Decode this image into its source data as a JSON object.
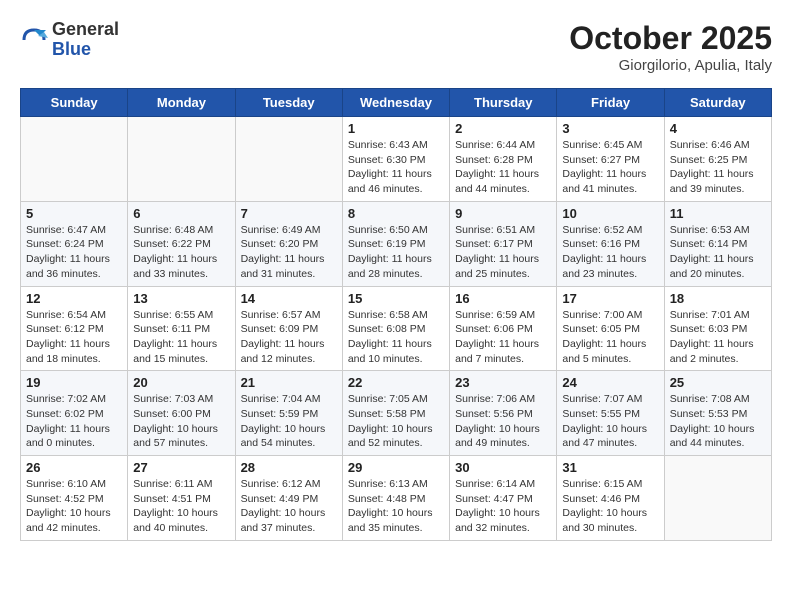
{
  "logo": {
    "general": "General",
    "blue": "Blue"
  },
  "header": {
    "month": "October 2025",
    "location": "Giorgilorio, Apulia, Italy"
  },
  "weekdays": [
    "Sunday",
    "Monday",
    "Tuesday",
    "Wednesday",
    "Thursday",
    "Friday",
    "Saturday"
  ],
  "weeks": [
    [
      {
        "day": "",
        "info": ""
      },
      {
        "day": "",
        "info": ""
      },
      {
        "day": "",
        "info": ""
      },
      {
        "day": "1",
        "info": "Sunrise: 6:43 AM\nSunset: 6:30 PM\nDaylight: 11 hours and 46 minutes."
      },
      {
        "day": "2",
        "info": "Sunrise: 6:44 AM\nSunset: 6:28 PM\nDaylight: 11 hours and 44 minutes."
      },
      {
        "day": "3",
        "info": "Sunrise: 6:45 AM\nSunset: 6:27 PM\nDaylight: 11 hours and 41 minutes."
      },
      {
        "day": "4",
        "info": "Sunrise: 6:46 AM\nSunset: 6:25 PM\nDaylight: 11 hours and 39 minutes."
      }
    ],
    [
      {
        "day": "5",
        "info": "Sunrise: 6:47 AM\nSunset: 6:24 PM\nDaylight: 11 hours and 36 minutes."
      },
      {
        "day": "6",
        "info": "Sunrise: 6:48 AM\nSunset: 6:22 PM\nDaylight: 11 hours and 33 minutes."
      },
      {
        "day": "7",
        "info": "Sunrise: 6:49 AM\nSunset: 6:20 PM\nDaylight: 11 hours and 31 minutes."
      },
      {
        "day": "8",
        "info": "Sunrise: 6:50 AM\nSunset: 6:19 PM\nDaylight: 11 hours and 28 minutes."
      },
      {
        "day": "9",
        "info": "Sunrise: 6:51 AM\nSunset: 6:17 PM\nDaylight: 11 hours and 25 minutes."
      },
      {
        "day": "10",
        "info": "Sunrise: 6:52 AM\nSunset: 6:16 PM\nDaylight: 11 hours and 23 minutes."
      },
      {
        "day": "11",
        "info": "Sunrise: 6:53 AM\nSunset: 6:14 PM\nDaylight: 11 hours and 20 minutes."
      }
    ],
    [
      {
        "day": "12",
        "info": "Sunrise: 6:54 AM\nSunset: 6:12 PM\nDaylight: 11 hours and 18 minutes."
      },
      {
        "day": "13",
        "info": "Sunrise: 6:55 AM\nSunset: 6:11 PM\nDaylight: 11 hours and 15 minutes."
      },
      {
        "day": "14",
        "info": "Sunrise: 6:57 AM\nSunset: 6:09 PM\nDaylight: 11 hours and 12 minutes."
      },
      {
        "day": "15",
        "info": "Sunrise: 6:58 AM\nSunset: 6:08 PM\nDaylight: 11 hours and 10 minutes."
      },
      {
        "day": "16",
        "info": "Sunrise: 6:59 AM\nSunset: 6:06 PM\nDaylight: 11 hours and 7 minutes."
      },
      {
        "day": "17",
        "info": "Sunrise: 7:00 AM\nSunset: 6:05 PM\nDaylight: 11 hours and 5 minutes."
      },
      {
        "day": "18",
        "info": "Sunrise: 7:01 AM\nSunset: 6:03 PM\nDaylight: 11 hours and 2 minutes."
      }
    ],
    [
      {
        "day": "19",
        "info": "Sunrise: 7:02 AM\nSunset: 6:02 PM\nDaylight: 11 hours and 0 minutes."
      },
      {
        "day": "20",
        "info": "Sunrise: 7:03 AM\nSunset: 6:00 PM\nDaylight: 10 hours and 57 minutes."
      },
      {
        "day": "21",
        "info": "Sunrise: 7:04 AM\nSunset: 5:59 PM\nDaylight: 10 hours and 54 minutes."
      },
      {
        "day": "22",
        "info": "Sunrise: 7:05 AM\nSunset: 5:58 PM\nDaylight: 10 hours and 52 minutes."
      },
      {
        "day": "23",
        "info": "Sunrise: 7:06 AM\nSunset: 5:56 PM\nDaylight: 10 hours and 49 minutes."
      },
      {
        "day": "24",
        "info": "Sunrise: 7:07 AM\nSunset: 5:55 PM\nDaylight: 10 hours and 47 minutes."
      },
      {
        "day": "25",
        "info": "Sunrise: 7:08 AM\nSunset: 5:53 PM\nDaylight: 10 hours and 44 minutes."
      }
    ],
    [
      {
        "day": "26",
        "info": "Sunrise: 6:10 AM\nSunset: 4:52 PM\nDaylight: 10 hours and 42 minutes."
      },
      {
        "day": "27",
        "info": "Sunrise: 6:11 AM\nSunset: 4:51 PM\nDaylight: 10 hours and 40 minutes."
      },
      {
        "day": "28",
        "info": "Sunrise: 6:12 AM\nSunset: 4:49 PM\nDaylight: 10 hours and 37 minutes."
      },
      {
        "day": "29",
        "info": "Sunrise: 6:13 AM\nSunset: 4:48 PM\nDaylight: 10 hours and 35 minutes."
      },
      {
        "day": "30",
        "info": "Sunrise: 6:14 AM\nSunset: 4:47 PM\nDaylight: 10 hours and 32 minutes."
      },
      {
        "day": "31",
        "info": "Sunrise: 6:15 AM\nSunset: 4:46 PM\nDaylight: 10 hours and 30 minutes."
      },
      {
        "day": "",
        "info": ""
      }
    ]
  ]
}
